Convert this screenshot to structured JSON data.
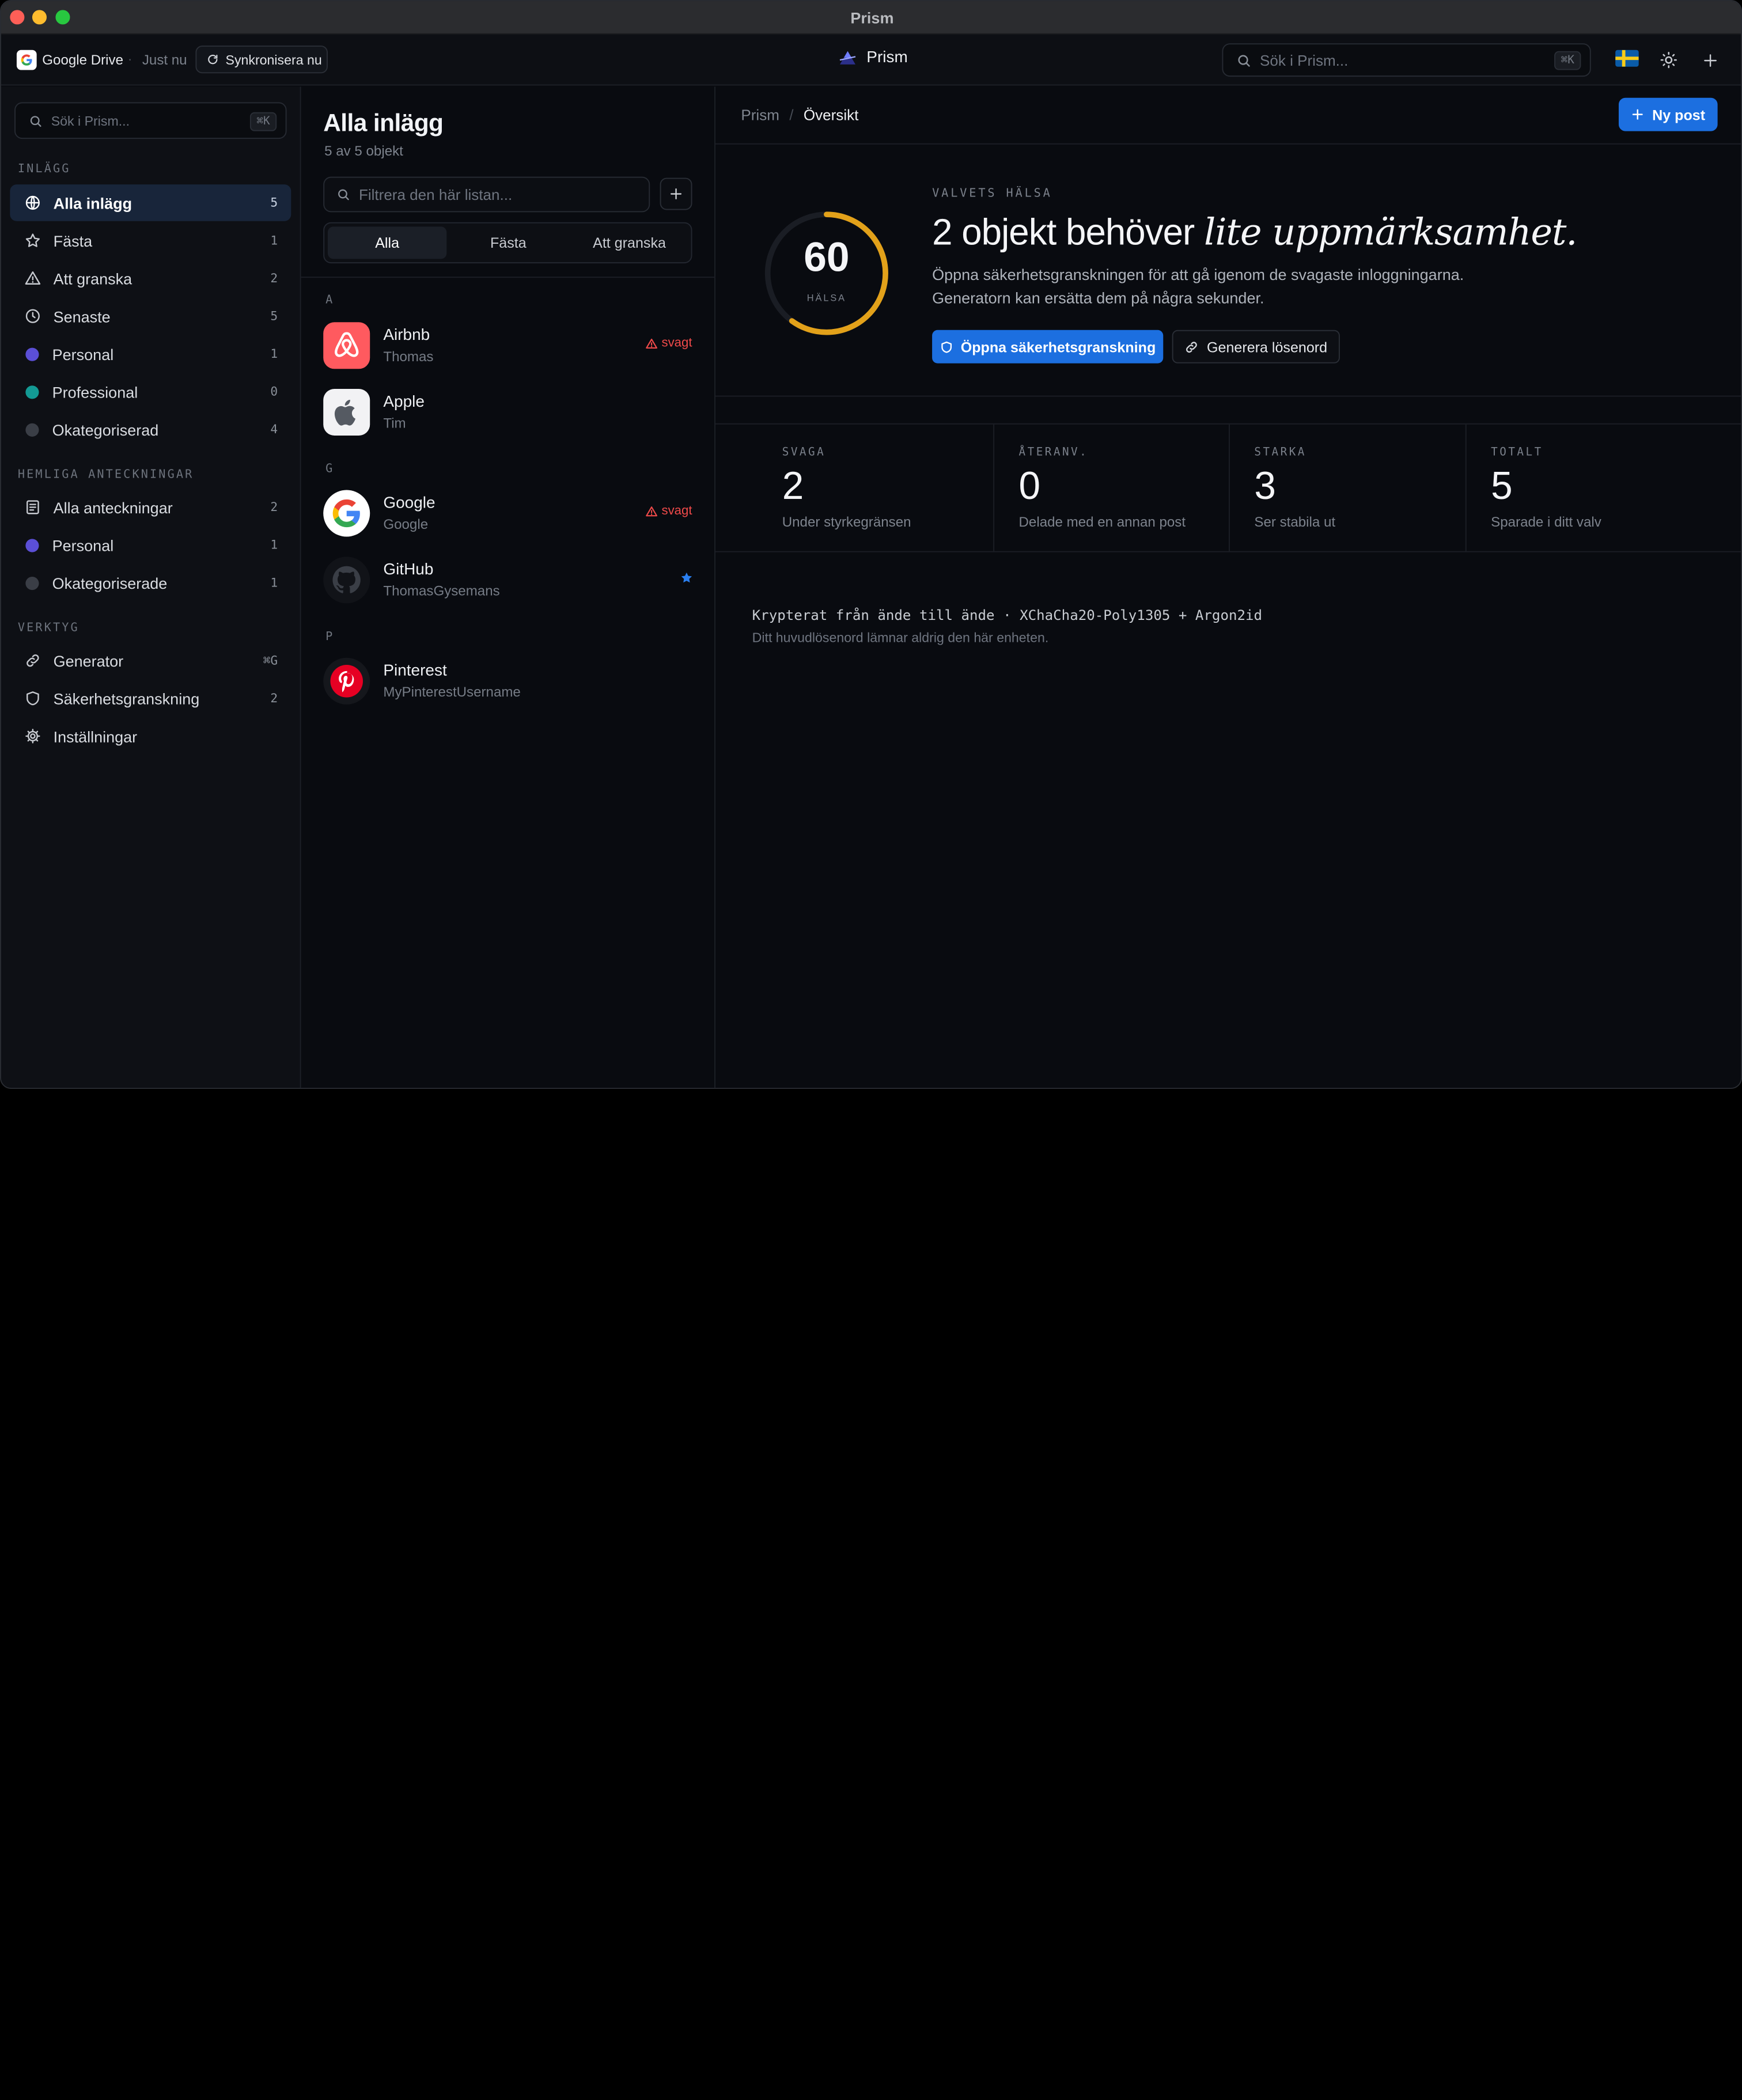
{
  "window": {
    "title": "Prism"
  },
  "topbar": {
    "provider": "Google Drive",
    "separator": "·",
    "sync_time": "Just nu",
    "sync_label": "Synkronisera nu",
    "brand": "Prism",
    "search_placeholder": "Sök i Prism...",
    "search_kbd": "⌘K"
  },
  "sidebar": {
    "search_placeholder": "Sök i Prism...",
    "search_kbd": "⌘K",
    "sections": {
      "posts": "INLÄGG",
      "notes": "HEMLIGA ANTECKNINGAR",
      "tools": "VERKTYG"
    },
    "posts": [
      {
        "label": "Alla inlägg",
        "count": "5"
      },
      {
        "label": "Fästa",
        "count": "1"
      },
      {
        "label": "Att granska",
        "count": "2"
      },
      {
        "label": "Senaste",
        "count": "5"
      },
      {
        "label": "Personal",
        "count": "1",
        "color": "#5b4fd6"
      },
      {
        "label": "Professional",
        "count": "0",
        "color": "#139a94"
      },
      {
        "label": "Okategoriserad",
        "count": "4",
        "color": "#3a3e46"
      }
    ],
    "notes": [
      {
        "label": "Alla anteckningar",
        "count": "2"
      },
      {
        "label": "Personal",
        "count": "1",
        "color": "#5b4fd6"
      },
      {
        "label": "Okategoriserade",
        "count": "1",
        "color": "#3a3e46"
      }
    ],
    "tools": [
      {
        "label": "Generator",
        "count": "⌘G"
      },
      {
        "label": "Säkerhetsgranskning",
        "count": "2"
      },
      {
        "label": "Inställningar",
        "count": ""
      }
    ]
  },
  "list": {
    "title": "Alla inlägg",
    "subtitle": "5 av 5 objekt",
    "filter_placeholder": "Filtrera den här listan...",
    "tabs": [
      "Alla",
      "Fästa",
      "Att granska"
    ],
    "groups": [
      {
        "letter": "A",
        "items": [
          {
            "name": "Airbnb",
            "user": "Thomas",
            "badge": "svagt"
          },
          {
            "name": "Apple",
            "user": "Tim",
            "badge": ""
          }
        ]
      },
      {
        "letter": "G",
        "items": [
          {
            "name": "Google",
            "user": "Google",
            "badge": "svagt"
          },
          {
            "name": "GitHub",
            "user": "ThomasGysemans",
            "badge": ""
          }
        ]
      },
      {
        "letter": "P",
        "items": [
          {
            "name": "Pinterest",
            "user": "MyPinterestUsername",
            "badge": ""
          }
        ]
      }
    ]
  },
  "main": {
    "breadcrumb": [
      "Prism",
      "/",
      "Översikt"
    ],
    "new_post": "Ny post",
    "health": {
      "score": "60",
      "score_fraction": 0.6,
      "score_label": "HÄLSA",
      "section_label": "VALVETS HÄLSA",
      "headline_plain": "2 objekt behöver",
      "headline_emphasis": "lite uppmärksamhet.",
      "desc_line1": "Öppna säkerhetsgranskningen för att gå igenom de svagaste inloggningarna.",
      "desc_line2": "Generatorn kan ersätta dem på några sekunder.",
      "audit_button": "Öppna säkerhetsgranskning",
      "generate_button": "Generera lösenord",
      "accent": "#e2a11a"
    },
    "stats": [
      {
        "label": "SVAGA",
        "value": "2",
        "desc": "Under styrkegränsen"
      },
      {
        "label": "ÅTERANV.",
        "value": "0",
        "desc": "Delade med en annan post"
      },
      {
        "label": "STARKA",
        "value": "3",
        "desc": "Ser stabila ut"
      },
      {
        "label": "TOTALT",
        "value": "5",
        "desc": "Sparade i ditt valv"
      }
    ],
    "footer_line1": "Krypterat från ände till ände · XChaCha20-Poly1305 + Argon2id",
    "footer_line2": "Ditt huvudlösenord lämnar aldrig den här enheten."
  }
}
